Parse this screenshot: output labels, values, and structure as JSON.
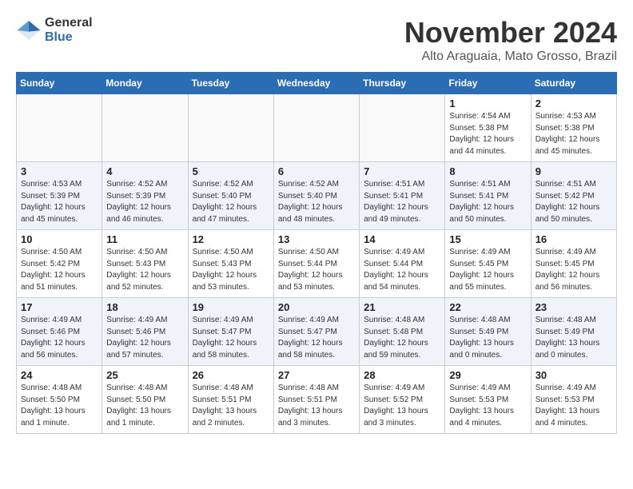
{
  "logo": {
    "general": "General",
    "blue": "Blue"
  },
  "title": "November 2024",
  "location": "Alto Araguaia, Mato Grosso, Brazil",
  "weekdays": [
    "Sunday",
    "Monday",
    "Tuesday",
    "Wednesday",
    "Thursday",
    "Friday",
    "Saturday"
  ],
  "weeks": [
    [
      {
        "day": "",
        "info": ""
      },
      {
        "day": "",
        "info": ""
      },
      {
        "day": "",
        "info": ""
      },
      {
        "day": "",
        "info": ""
      },
      {
        "day": "",
        "info": ""
      },
      {
        "day": "1",
        "info": "Sunrise: 4:54 AM\nSunset: 5:38 PM\nDaylight: 12 hours\nand 44 minutes."
      },
      {
        "day": "2",
        "info": "Sunrise: 4:53 AM\nSunset: 5:38 PM\nDaylight: 12 hours\nand 45 minutes."
      }
    ],
    [
      {
        "day": "3",
        "info": "Sunrise: 4:53 AM\nSunset: 5:39 PM\nDaylight: 12 hours\nand 45 minutes."
      },
      {
        "day": "4",
        "info": "Sunrise: 4:52 AM\nSunset: 5:39 PM\nDaylight: 12 hours\nand 46 minutes."
      },
      {
        "day": "5",
        "info": "Sunrise: 4:52 AM\nSunset: 5:40 PM\nDaylight: 12 hours\nand 47 minutes."
      },
      {
        "day": "6",
        "info": "Sunrise: 4:52 AM\nSunset: 5:40 PM\nDaylight: 12 hours\nand 48 minutes."
      },
      {
        "day": "7",
        "info": "Sunrise: 4:51 AM\nSunset: 5:41 PM\nDaylight: 12 hours\nand 49 minutes."
      },
      {
        "day": "8",
        "info": "Sunrise: 4:51 AM\nSunset: 5:41 PM\nDaylight: 12 hours\nand 50 minutes."
      },
      {
        "day": "9",
        "info": "Sunrise: 4:51 AM\nSunset: 5:42 PM\nDaylight: 12 hours\nand 50 minutes."
      }
    ],
    [
      {
        "day": "10",
        "info": "Sunrise: 4:50 AM\nSunset: 5:42 PM\nDaylight: 12 hours\nand 51 minutes."
      },
      {
        "day": "11",
        "info": "Sunrise: 4:50 AM\nSunset: 5:43 PM\nDaylight: 12 hours\nand 52 minutes."
      },
      {
        "day": "12",
        "info": "Sunrise: 4:50 AM\nSunset: 5:43 PM\nDaylight: 12 hours\nand 53 minutes."
      },
      {
        "day": "13",
        "info": "Sunrise: 4:50 AM\nSunset: 5:44 PM\nDaylight: 12 hours\nand 53 minutes."
      },
      {
        "day": "14",
        "info": "Sunrise: 4:49 AM\nSunset: 5:44 PM\nDaylight: 12 hours\nand 54 minutes."
      },
      {
        "day": "15",
        "info": "Sunrise: 4:49 AM\nSunset: 5:45 PM\nDaylight: 12 hours\nand 55 minutes."
      },
      {
        "day": "16",
        "info": "Sunrise: 4:49 AM\nSunset: 5:45 PM\nDaylight: 12 hours\nand 56 minutes."
      }
    ],
    [
      {
        "day": "17",
        "info": "Sunrise: 4:49 AM\nSunset: 5:46 PM\nDaylight: 12 hours\nand 56 minutes."
      },
      {
        "day": "18",
        "info": "Sunrise: 4:49 AM\nSunset: 5:46 PM\nDaylight: 12 hours\nand 57 minutes."
      },
      {
        "day": "19",
        "info": "Sunrise: 4:49 AM\nSunset: 5:47 PM\nDaylight: 12 hours\nand 58 minutes."
      },
      {
        "day": "20",
        "info": "Sunrise: 4:49 AM\nSunset: 5:47 PM\nDaylight: 12 hours\nand 58 minutes."
      },
      {
        "day": "21",
        "info": "Sunrise: 4:48 AM\nSunset: 5:48 PM\nDaylight: 12 hours\nand 59 minutes."
      },
      {
        "day": "22",
        "info": "Sunrise: 4:48 AM\nSunset: 5:49 PM\nDaylight: 13 hours\nand 0 minutes."
      },
      {
        "day": "23",
        "info": "Sunrise: 4:48 AM\nSunset: 5:49 PM\nDaylight: 13 hours\nand 0 minutes."
      }
    ],
    [
      {
        "day": "24",
        "info": "Sunrise: 4:48 AM\nSunset: 5:50 PM\nDaylight: 13 hours\nand 1 minute."
      },
      {
        "day": "25",
        "info": "Sunrise: 4:48 AM\nSunset: 5:50 PM\nDaylight: 13 hours\nand 1 minute."
      },
      {
        "day": "26",
        "info": "Sunrise: 4:48 AM\nSunset: 5:51 PM\nDaylight: 13 hours\nand 2 minutes."
      },
      {
        "day": "27",
        "info": "Sunrise: 4:48 AM\nSunset: 5:51 PM\nDaylight: 13 hours\nand 3 minutes."
      },
      {
        "day": "28",
        "info": "Sunrise: 4:49 AM\nSunset: 5:52 PM\nDaylight: 13 hours\nand 3 minutes."
      },
      {
        "day": "29",
        "info": "Sunrise: 4:49 AM\nSunset: 5:53 PM\nDaylight: 13 hours\nand 4 minutes."
      },
      {
        "day": "30",
        "info": "Sunrise: 4:49 AM\nSunset: 5:53 PM\nDaylight: 13 hours\nand 4 minutes."
      }
    ]
  ]
}
